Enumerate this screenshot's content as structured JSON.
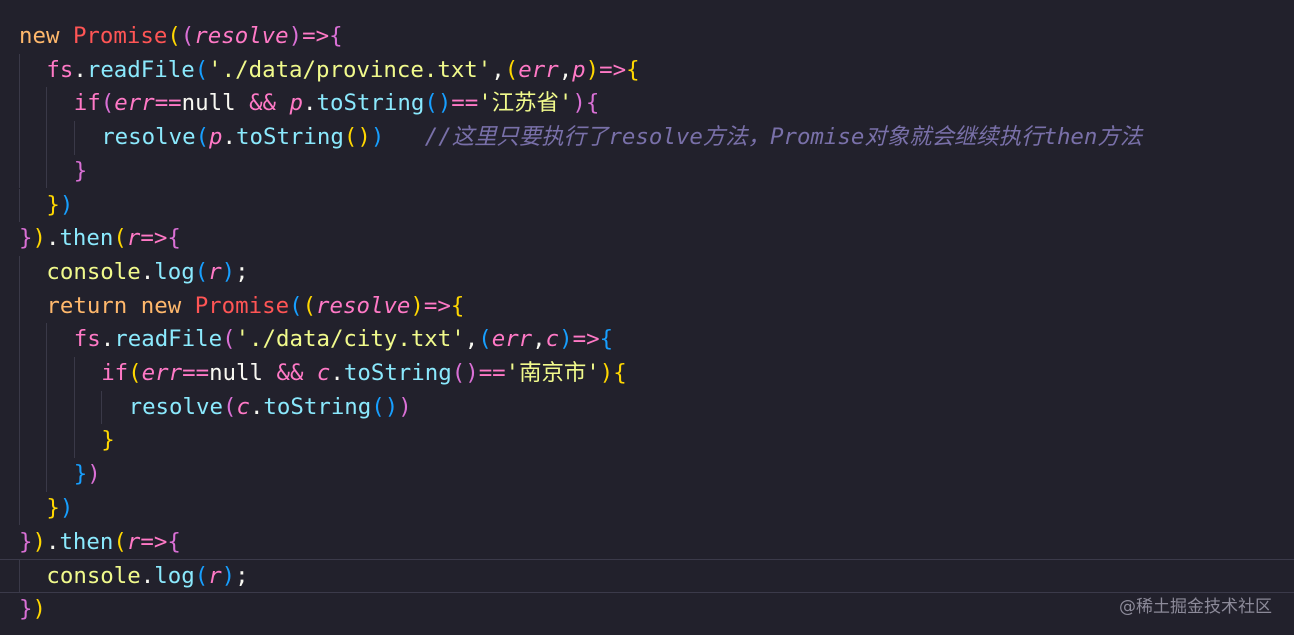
{
  "editor": {
    "language": "javascript",
    "lines": [
      {
        "indent": 0,
        "tokens": [
          {
            "t": "new",
            "c": "kw"
          },
          {
            "t": " ",
            "c": "pl"
          },
          {
            "t": "Promise",
            "c": "cls"
          },
          {
            "t": "(",
            "c": "b1"
          },
          {
            "t": "(",
            "c": "b2"
          },
          {
            "t": "resolve",
            "c": "prm"
          },
          {
            "t": ")",
            "c": "b2"
          },
          {
            "t": "=>",
            "c": "op"
          },
          {
            "t": "{",
            "c": "b2"
          }
        ]
      },
      {
        "indent": 1,
        "tokens": [
          {
            "t": "fs",
            "c": "obj"
          },
          {
            "t": ".",
            "c": "pl"
          },
          {
            "t": "readFile",
            "c": "fn"
          },
          {
            "t": "(",
            "c": "b3"
          },
          {
            "t": "'./data/province.txt'",
            "c": "str"
          },
          {
            "t": ",",
            "c": "pl"
          },
          {
            "t": "(",
            "c": "b1"
          },
          {
            "t": "err",
            "c": "prm"
          },
          {
            "t": ",",
            "c": "pl"
          },
          {
            "t": "p",
            "c": "prm"
          },
          {
            "t": ")",
            "c": "b1"
          },
          {
            "t": "=>",
            "c": "op"
          },
          {
            "t": "{",
            "c": "b1"
          }
        ]
      },
      {
        "indent": 2,
        "tokens": [
          {
            "t": "if",
            "c": "obj"
          },
          {
            "t": "(",
            "c": "b2"
          },
          {
            "t": "err",
            "c": "prm"
          },
          {
            "t": "==",
            "c": "op"
          },
          {
            "t": "null",
            "c": "pl"
          },
          {
            "t": " && ",
            "c": "op"
          },
          {
            "t": "p",
            "c": "prm"
          },
          {
            "t": ".",
            "c": "pl"
          },
          {
            "t": "toString",
            "c": "fn"
          },
          {
            "t": "(",
            "c": "b3"
          },
          {
            "t": ")",
            "c": "b3"
          },
          {
            "t": "==",
            "c": "op"
          },
          {
            "t": "'江苏省'",
            "c": "str"
          },
          {
            "t": ")",
            "c": "b2"
          },
          {
            "t": "{",
            "c": "b2"
          }
        ]
      },
      {
        "indent": 3,
        "tokens": [
          {
            "t": "resolve",
            "c": "fn"
          },
          {
            "t": "(",
            "c": "b3"
          },
          {
            "t": "p",
            "c": "prm"
          },
          {
            "t": ".",
            "c": "pl"
          },
          {
            "t": "toString",
            "c": "fn"
          },
          {
            "t": "(",
            "c": "b1"
          },
          {
            "t": ")",
            "c": "b1"
          },
          {
            "t": ")",
            "c": "b3"
          },
          {
            "t": "   //这里只要执行了resolve方法，Promise对象就会继续执行then方法",
            "c": "cm"
          }
        ]
      },
      {
        "indent": 2,
        "tokens": [
          {
            "t": "}",
            "c": "b2"
          }
        ]
      },
      {
        "indent": 1,
        "tokens": [
          {
            "t": "}",
            "c": "b1"
          },
          {
            "t": ")",
            "c": "b3"
          }
        ]
      },
      {
        "indent": 0,
        "tokens": [
          {
            "t": "}",
            "c": "b2"
          },
          {
            "t": ")",
            "c": "b1"
          },
          {
            "t": ".",
            "c": "pl"
          },
          {
            "t": "then",
            "c": "fn"
          },
          {
            "t": "(",
            "c": "b1"
          },
          {
            "t": "r",
            "c": "prm"
          },
          {
            "t": "=>",
            "c": "op"
          },
          {
            "t": "{",
            "c": "b2"
          }
        ]
      },
      {
        "indent": 1,
        "tokens": [
          {
            "t": "console",
            "c": "cn"
          },
          {
            "t": ".",
            "c": "pl"
          },
          {
            "t": "log",
            "c": "fn"
          },
          {
            "t": "(",
            "c": "b3"
          },
          {
            "t": "r",
            "c": "prm"
          },
          {
            "t": ")",
            "c": "b3"
          },
          {
            "t": ";",
            "c": "pl"
          }
        ]
      },
      {
        "indent": 1,
        "tokens": [
          {
            "t": "return",
            "c": "kw"
          },
          {
            "t": " ",
            "c": "pl"
          },
          {
            "t": "new",
            "c": "kw"
          },
          {
            "t": " ",
            "c": "pl"
          },
          {
            "t": "Promise",
            "c": "cls"
          },
          {
            "t": "(",
            "c": "b3"
          },
          {
            "t": "(",
            "c": "b1"
          },
          {
            "t": "resolve",
            "c": "prm"
          },
          {
            "t": ")",
            "c": "b1"
          },
          {
            "t": "=>",
            "c": "op"
          },
          {
            "t": "{",
            "c": "b1"
          }
        ]
      },
      {
        "indent": 2,
        "tokens": [
          {
            "t": "fs",
            "c": "obj"
          },
          {
            "t": ".",
            "c": "pl"
          },
          {
            "t": "readFile",
            "c": "fn"
          },
          {
            "t": "(",
            "c": "b2"
          },
          {
            "t": "'./data/city.txt'",
            "c": "str"
          },
          {
            "t": ",",
            "c": "pl"
          },
          {
            "t": "(",
            "c": "b3"
          },
          {
            "t": "err",
            "c": "prm"
          },
          {
            "t": ",",
            "c": "pl"
          },
          {
            "t": "c",
            "c": "prm"
          },
          {
            "t": ")",
            "c": "b3"
          },
          {
            "t": "=>",
            "c": "op"
          },
          {
            "t": "{",
            "c": "b3"
          }
        ]
      },
      {
        "indent": 3,
        "tokens": [
          {
            "t": "if",
            "c": "obj"
          },
          {
            "t": "(",
            "c": "b1"
          },
          {
            "t": "err",
            "c": "prm"
          },
          {
            "t": "==",
            "c": "op"
          },
          {
            "t": "null",
            "c": "pl"
          },
          {
            "t": " && ",
            "c": "op"
          },
          {
            "t": "c",
            "c": "prm"
          },
          {
            "t": ".",
            "c": "pl"
          },
          {
            "t": "toString",
            "c": "fn"
          },
          {
            "t": "(",
            "c": "b2"
          },
          {
            "t": ")",
            "c": "b2"
          },
          {
            "t": "==",
            "c": "op"
          },
          {
            "t": "'南京市'",
            "c": "str"
          },
          {
            "t": ")",
            "c": "b1"
          },
          {
            "t": "{",
            "c": "b1"
          }
        ]
      },
      {
        "indent": 4,
        "tokens": [
          {
            "t": "resolve",
            "c": "fn"
          },
          {
            "t": "(",
            "c": "b2"
          },
          {
            "t": "c",
            "c": "prm"
          },
          {
            "t": ".",
            "c": "pl"
          },
          {
            "t": "toString",
            "c": "fn"
          },
          {
            "t": "(",
            "c": "b3"
          },
          {
            "t": ")",
            "c": "b3"
          },
          {
            "t": ")",
            "c": "b2"
          }
        ]
      },
      {
        "indent": 3,
        "tokens": [
          {
            "t": "}",
            "c": "b1"
          }
        ]
      },
      {
        "indent": 2,
        "tokens": [
          {
            "t": "}",
            "c": "b3"
          },
          {
            "t": ")",
            "c": "b2"
          }
        ]
      },
      {
        "indent": 1,
        "tokens": [
          {
            "t": "}",
            "c": "b1"
          },
          {
            "t": ")",
            "c": "b3"
          }
        ]
      },
      {
        "indent": 0,
        "tokens": [
          {
            "t": "}",
            "c": "b2"
          },
          {
            "t": ")",
            "c": "b1"
          },
          {
            "t": ".",
            "c": "pl"
          },
          {
            "t": "then",
            "c": "fn"
          },
          {
            "t": "(",
            "c": "b1"
          },
          {
            "t": "r",
            "c": "prm"
          },
          {
            "t": "=>",
            "c": "op"
          },
          {
            "t": "{",
            "c": "b2"
          }
        ]
      },
      {
        "indent": 1,
        "current": true,
        "tokens": [
          {
            "t": "console",
            "c": "cn"
          },
          {
            "t": ".",
            "c": "pl"
          },
          {
            "t": "log",
            "c": "fn"
          },
          {
            "t": "(",
            "c": "b3"
          },
          {
            "t": "r",
            "c": "prm"
          },
          {
            "t": ")",
            "c": "b3"
          },
          {
            "t": ";",
            "c": "pl"
          }
        ]
      },
      {
        "indent": 0,
        "tokens": [
          {
            "t": "}",
            "c": "b2"
          },
          {
            "t": ")",
            "c": "b1"
          }
        ]
      }
    ]
  },
  "watermark": "@稀土掘金技术社区",
  "colors": {
    "background": "#22212c",
    "keyword": "#ffb86c",
    "class": "#ff5555",
    "function": "#8be9fd",
    "parameter": "#ff79c6",
    "string": "#f1fa8c",
    "comment": "#7970a9"
  }
}
